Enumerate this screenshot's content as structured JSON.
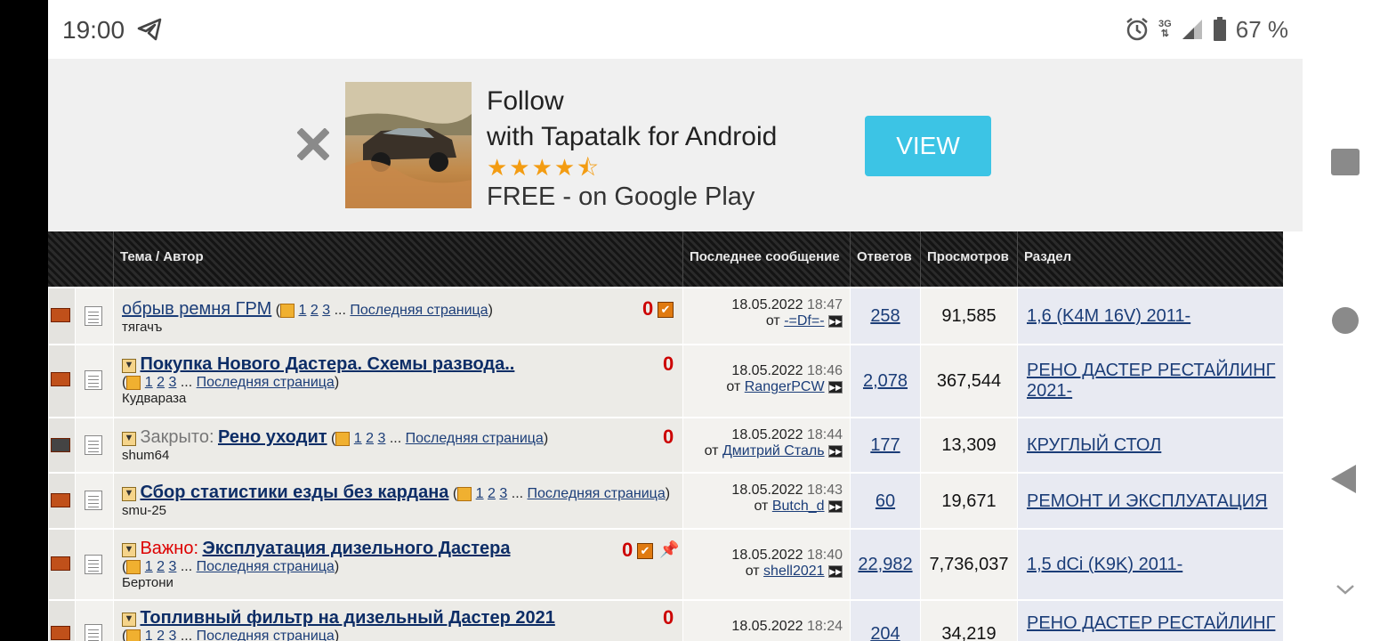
{
  "statusbar": {
    "time": "19:00",
    "network": "3G",
    "battery": "67 %"
  },
  "ad": {
    "title1": "Follow",
    "title2": "with Tapatalk for Android",
    "stars": "★★★★⯪",
    "subtitle": "FREE - on Google Play",
    "button": "VIEW"
  },
  "table": {
    "headers": [
      "Тема / Автор",
      "Последнее сообщение",
      "Ответов",
      "Просмотров",
      "Раздел"
    ],
    "last_page_label": "Последняя страница",
    "from_label": "от",
    "rows": [
      {
        "prefix": "",
        "title": "обрыв ремня ГРМ",
        "bold": false,
        "pages": [
          "1",
          "2",
          "3"
        ],
        "author": "тягачъ",
        "date": "18.05.2022",
        "time": "18:47",
        "last_user": "-=Df=-",
        "replies": "258",
        "views": "91,585",
        "section": "1,6 (K4M 16V) 2011-"
      },
      {
        "prefix": "",
        "title": "Покупка Нового Дастера. Схемы развода..",
        "bold": true,
        "pages": [
          "1",
          "2",
          "3"
        ],
        "author": "Кудвараза",
        "date": "18.05.2022",
        "time": "18:46",
        "last_user": "RangerPCW",
        "replies": "2,078",
        "views": "367,544",
        "section": "РЕНО ДАСТЕР РЕСТАЙЛИНГ 2021-"
      },
      {
        "prefix": "Закрыто:",
        "title": "Рено уходит",
        "bold": true,
        "pages": [
          "1",
          "2",
          "3"
        ],
        "author": "shum64",
        "date": "18.05.2022",
        "time": "18:44",
        "last_user": "Дмитрий Сталь",
        "replies": "177",
        "views": "13,309",
        "section": "КРУГЛЫЙ СТОЛ"
      },
      {
        "prefix": "",
        "title": "Сбор статистики езды без кардана",
        "bold": true,
        "pages": [
          "1",
          "2",
          "3"
        ],
        "author": "smu-25",
        "date": "18.05.2022",
        "time": "18:43",
        "last_user": "Butch_d",
        "replies": "60",
        "views": "19,671",
        "section": "РЕМОНТ И ЭКСПЛУАТАЦИЯ"
      },
      {
        "prefix": "Важно:",
        "title": "Эксплуатация дизельного Дастера",
        "bold": true,
        "pages": [
          "1",
          "2",
          "3"
        ],
        "author": "Бертони",
        "date": "18.05.2022",
        "time": "18:40",
        "last_user": "shell2021",
        "replies": "22,982",
        "views": "7,736,037",
        "section": "1,5 dCi (K9K) 2011-"
      },
      {
        "prefix": "",
        "title": "Топливный фильтр на дизельный Дастер 2021",
        "bold": true,
        "pages": [
          "1",
          "2",
          "3"
        ],
        "author": "",
        "date": "18.05.2022",
        "time": "18:24",
        "last_user": "",
        "replies": "204",
        "views": "34,219",
        "section": "РЕНО ДАСТЕР РЕСТАЙЛИНГ"
      }
    ]
  }
}
